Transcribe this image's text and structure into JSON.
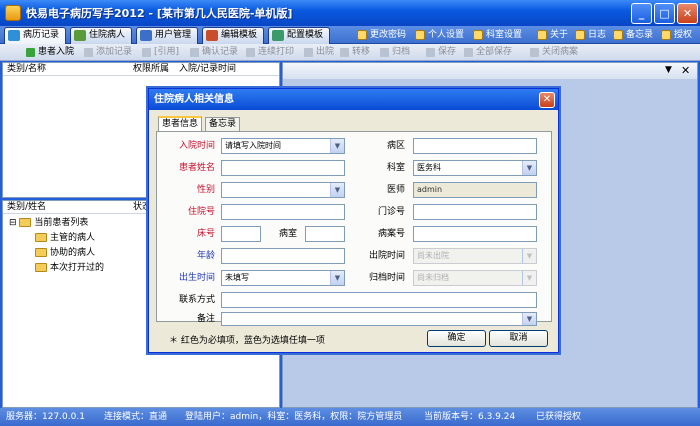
{
  "window": {
    "title": "快易电子病历写手2012 - [某市第几人民医院-单机版]",
    "min": "_",
    "max": "□",
    "close": "✕"
  },
  "tabs": [
    {
      "label": "病历记录",
      "color": "#2f8fd8"
    },
    {
      "label": "住院病人",
      "color": "#5a9a3a"
    },
    {
      "label": "用户管理",
      "color": "#3b6fc8"
    },
    {
      "label": "编辑模板",
      "color": "#c84d2a"
    },
    {
      "label": "配置模板",
      "color": "#3a9a6a"
    }
  ],
  "top_menu": [
    "更改密码",
    "个人设置",
    "科室设置",
    "关于",
    "日志",
    "备忘录",
    "授权"
  ],
  "toolbar": [
    "患者入院",
    "添加记录",
    "[引用]",
    "确认记录",
    "连续打印",
    "出院",
    "转移",
    "归档",
    "保存",
    "全部保存",
    "关闭病案"
  ],
  "left_top": {
    "col1": "类别/名称",
    "col2": "权限所属",
    "col3": "入院/记录时间"
  },
  "left_bottom": {
    "col1": "类别/姓名",
    "col2": "状态"
  },
  "tree": {
    "root": "当前患者列表",
    "children": [
      "主管的病人",
      "协助的病人",
      "本次打开过的"
    ],
    "toggle": "⊟"
  },
  "right_pane": {
    "dropdown": "▼",
    "close": "✕"
  },
  "dialog": {
    "title": "住院病人相关信息",
    "close": "✕",
    "tab1": "患者信息",
    "tab2": "备忘录",
    "labels": {
      "admit_time": "入院时间",
      "ward_area": "病区",
      "name": "患者姓名",
      "dept": "科室",
      "sex": "性别",
      "doctor": "医师",
      "inpatient_no": "住院号",
      "outpatient_no": "门诊号",
      "bed_no": "床号",
      "room": "病室",
      "case_no": "病案号",
      "age": "年龄",
      "discharge_time": "出院时间",
      "birth": "出生时间",
      "archive_time": "归档时间",
      "contact": "联系方式",
      "remark": "备注"
    },
    "values": {
      "admit_time": "请填写入院时间",
      "dept": "医务科",
      "doctor": "admin",
      "birth": "未填写",
      "discharge_time": "尚未出院",
      "archive_time": "尚未归档"
    },
    "hint": "＊ 红色为必填项，蓝色为选填任填一项",
    "ok": "确定",
    "cancel": "取消"
  },
  "status": {
    "server": "服务器：127.0.0.1",
    "mode": "连接模式：直通",
    "login": "登陆用户：admin，科室：医务科，权限：院方管理员",
    "version": "当前版本号：6.3.9.24",
    "auth": "已获得授权"
  }
}
